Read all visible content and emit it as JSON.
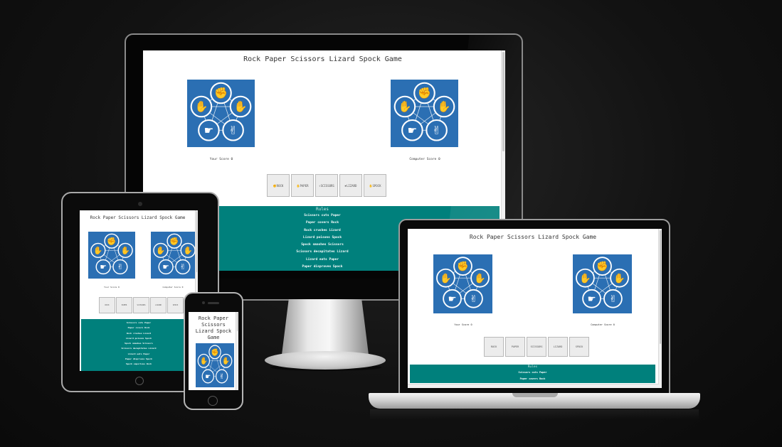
{
  "game": {
    "title": "Rock Paper Scissors Lizard Spock Game",
    "your_score_label": "Your Score",
    "your_score_value": "0",
    "computer_score_label": "Computer Score",
    "computer_score_value": "0",
    "buttons": [
      "ROCK",
      "PAPER",
      "SCISSORS",
      "LIZARD",
      "SPOCK"
    ],
    "rules_heading": "Rules",
    "rules": [
      "Scissors cuts Paper",
      "Paper covers Rock",
      "Rock crushes Lizard",
      "Lizard poisons Spock",
      "Spock smashes Scissors",
      "Scissors decapitates Lizard",
      "Lizard eats Paper",
      "Paper disproves Spock",
      "Spock vaporizes Rock"
    ]
  },
  "colors": {
    "rules_background": "#00807c",
    "image_background": "#2b6fb3",
    "page_background": "#ffffff",
    "backdrop": "#121212"
  },
  "icons": {
    "game_image": "rock-paper-scissors-lizard-spock-diagram",
    "button_icons": [
      "fist-icon",
      "hand-icon",
      "scissors-icon",
      "lizard-icon",
      "spock-icon"
    ]
  }
}
